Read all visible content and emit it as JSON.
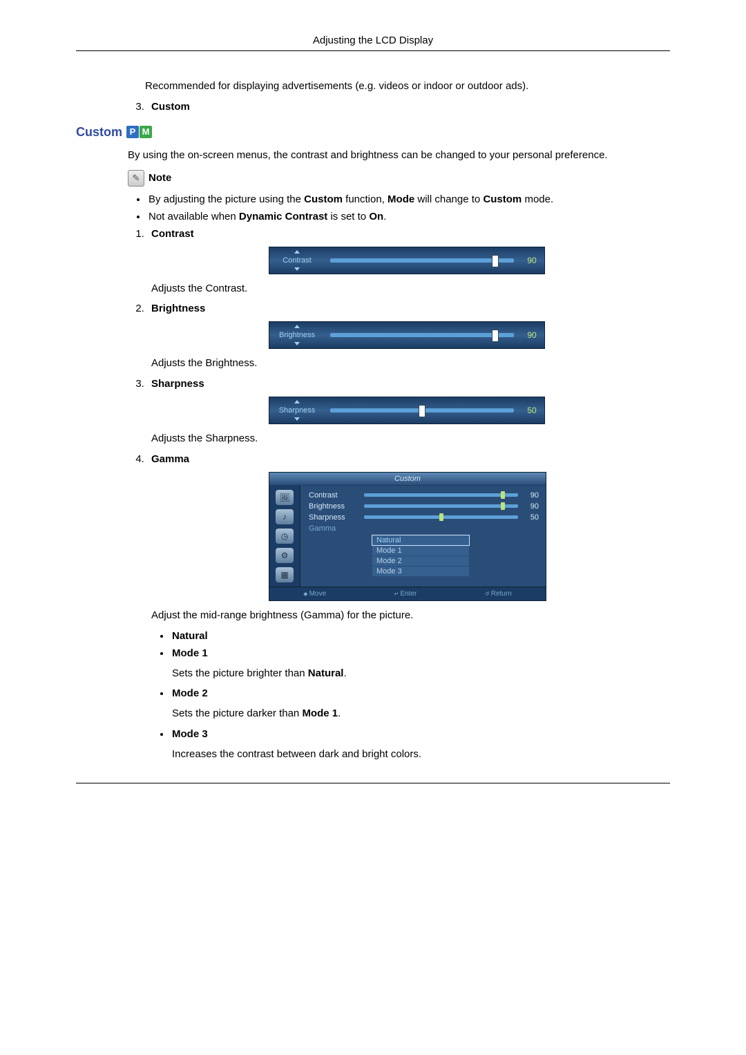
{
  "header": {
    "title": "Adjusting the LCD Display"
  },
  "intro_list": {
    "start": 3,
    "recommended_text": "Recommended for displaying advertisements (e.g. videos or indoor or outdoor ads).",
    "item3": "Custom"
  },
  "section": {
    "heading": "Custom",
    "badge_p": "P",
    "badge_m": "M",
    "intro": "By using the on-screen menus, the contrast and brightness can be changed to your personal preference.",
    "note_label": "Note",
    "notes": [
      {
        "pre": "By adjusting the picture using the ",
        "b1": "Custom",
        "mid1": " function, ",
        "b2": "Mode",
        "mid2": " will change to ",
        "b3": "Custom",
        "post": " mode."
      },
      {
        "pre": "Not available when ",
        "b1": "Dynamic Contrast",
        "mid1": " is set to ",
        "b2": "On",
        "post": "."
      }
    ]
  },
  "items": {
    "contrast": {
      "label": "Contrast",
      "value": "90",
      "pos": 90,
      "desc": "Adjusts the Contrast."
    },
    "brightness": {
      "label": "Brightness",
      "value": "90",
      "pos": 90,
      "desc": "Adjusts the Brightness."
    },
    "sharpness": {
      "label": "Sharpness",
      "value": "50",
      "pos": 50,
      "desc": "Adjusts the Sharpness."
    },
    "gamma": {
      "label": "Gamma",
      "desc": "Adjust the mid-range brightness (Gamma) for the picture.",
      "menu_title": "Custom",
      "rows": {
        "contrast": {
          "label": "Contrast",
          "val": "90",
          "pos": 90
        },
        "brightness": {
          "label": "Brightness",
          "val": "90",
          "pos": 90
        },
        "sharpness": {
          "label": "Sharpness",
          "val": "50",
          "pos": 50
        }
      },
      "gamma_label": "Gamma",
      "options": [
        "Natural",
        "Mode 1",
        "Mode 2",
        "Mode 3"
      ],
      "footer": {
        "move": "Move",
        "enter": "Enter",
        "return": "Return"
      }
    }
  },
  "gamma_modes": {
    "natural": "Natural",
    "mode1": {
      "label": "Mode 1",
      "desc_pre": "Sets the picture brighter than ",
      "desc_b": "Natural",
      "desc_post": "."
    },
    "mode2": {
      "label": "Mode 2",
      "desc_pre": "Sets the picture darker than ",
      "desc_b": "Mode 1",
      "desc_post": "."
    },
    "mode3": {
      "label": "Mode 3",
      "desc": "Increases the contrast between dark and bright colors."
    }
  }
}
